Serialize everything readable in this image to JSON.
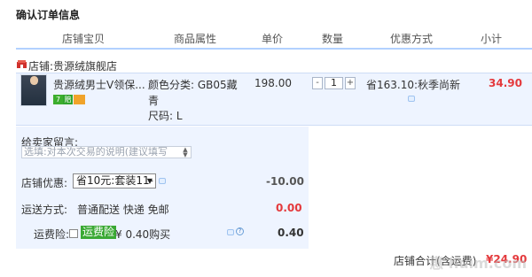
{
  "title": "确认订单信息",
  "columns": {
    "shop_item": "店铺宝贝",
    "attr": "商品属性",
    "price": "单价",
    "qty": "数量",
    "discount": "优惠方式",
    "subtotal": "小计"
  },
  "shop": {
    "prefix": "店铺:",
    "name": "贵源绒旗舰店"
  },
  "item": {
    "name": "贵源绒男士V领保...",
    "badges": {
      "seven_day": "7",
      "guarantee": "赔"
    },
    "color_line1": "颜色分类: GB05藏",
    "color_line2": "青",
    "size": "尺码: L",
    "price": "198.00",
    "qty": "1",
    "qty_minus": "-",
    "qty_plus": "+",
    "promo": "省163.10:秋季尚新",
    "subtotal": "34.90"
  },
  "note": {
    "label": "给卖家留言:",
    "placeholder": "选填:对本次交易的说明(建议填写"
  },
  "shop_discount": {
    "label": "店铺优惠:",
    "selected": "省10元:套装11-",
    "amount": "-10.00"
  },
  "shipping": {
    "label": "运送方式:",
    "method": "普通配送 快递 免邮",
    "amount": "0.00"
  },
  "insurance": {
    "label": "运费险:",
    "tag": "运费险",
    "desc": "¥ 0.40购买",
    "amount": "0.40"
  },
  "total": {
    "label": "店铺合计(含运费)",
    "amount": "¥24.90"
  },
  "watermark": "惠 huim.com",
  "colors": {
    "accent_red": "#e4393c",
    "header_line": "#b2d1ff",
    "row_bg": "#eef4ff",
    "tag_green": "#3aa934"
  }
}
